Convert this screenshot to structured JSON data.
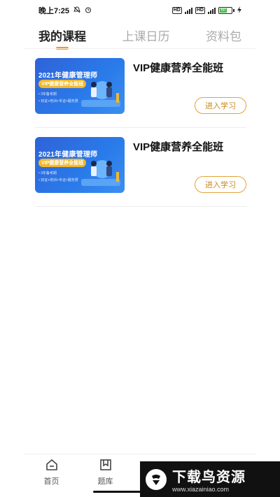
{
  "status": {
    "time": "晚上7:25",
    "battery": "60"
  },
  "tabs": [
    {
      "label": "我的课程"
    },
    {
      "label": "上课日历"
    },
    {
      "label": "资料包"
    }
  ],
  "courses": [
    {
      "title": "VIP健康营养全能班",
      "button": "进入学习",
      "thumb_title": "2021年健康管理师",
      "thumb_badge": "VIP健康营养全能班",
      "thumb_line1": "• 3年备考期",
      "thumb_line2": "• 双证+培训+专证+服务费"
    },
    {
      "title": "VIP健康营养全能班",
      "button": "进入学习",
      "thumb_title": "2021年健康管理师",
      "thumb_badge": "VIP健康营养全能班",
      "thumb_line1": "• 3年备考期",
      "thumb_line2": "• 双证+培训+专证+服务费"
    }
  ],
  "bottom_nav": [
    {
      "label": "首页",
      "icon": "home-icon"
    },
    {
      "label": "题库",
      "icon": "bookmark-icon"
    }
  ],
  "watermark": {
    "text": "下载鸟资源",
    "url": "www.xiazainiao.com"
  },
  "colors": {
    "accent": "#f19a1e",
    "button_border": "#e2a33a",
    "thumb_blue": "#2a7bea"
  }
}
